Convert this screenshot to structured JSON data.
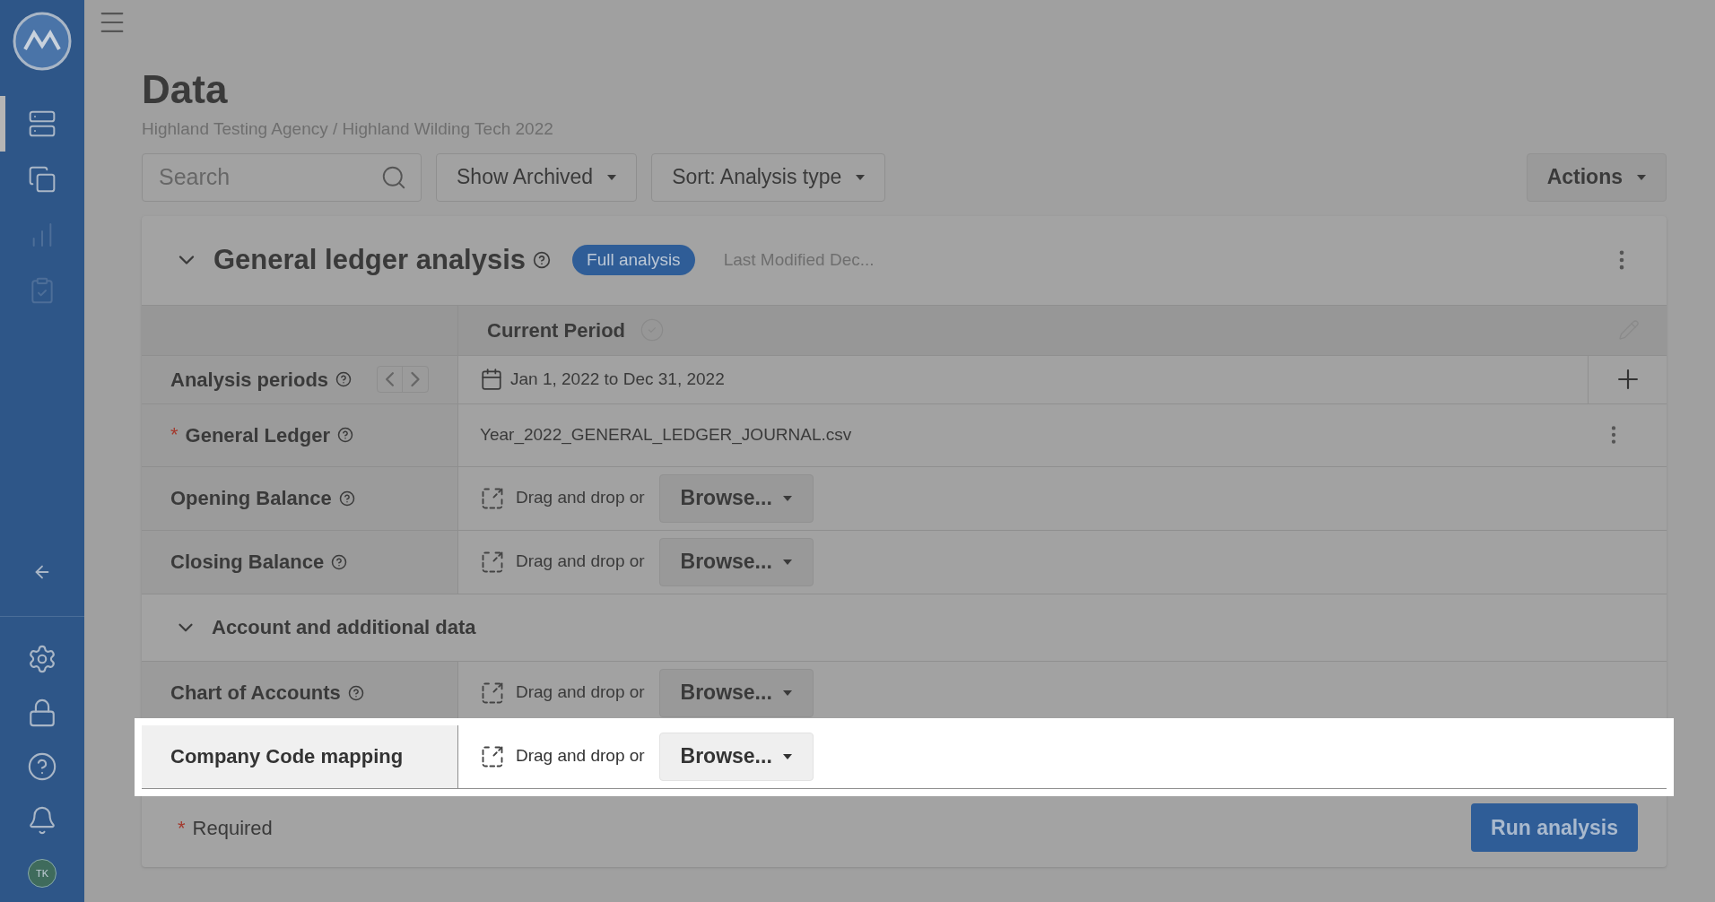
{
  "sidebar": {
    "nav": [
      {
        "kind": "data",
        "selected": true,
        "disabled": false
      },
      {
        "kind": "files",
        "selected": false,
        "disabled": false
      },
      {
        "kind": "chart",
        "selected": false,
        "disabled": true
      },
      {
        "kind": "review",
        "selected": false,
        "disabled": true
      }
    ],
    "bottom": [
      {
        "kind": "settings"
      },
      {
        "kind": "lock"
      },
      {
        "kind": "help"
      },
      {
        "kind": "bell"
      }
    ],
    "avatar": "TK"
  },
  "page": {
    "title": "Data",
    "breadcrumb": "Highland Testing Agency / Highland Wilding Tech 2022"
  },
  "toolbar": {
    "search": {
      "placeholder": "Search"
    },
    "show_archived": "Show Archived",
    "sort": "Sort: Analysis type",
    "actions": "Actions"
  },
  "analysis": {
    "title": "General ledger analysis",
    "expanded": true,
    "badge": "Full analysis",
    "modified": "Last Modified Dec...",
    "column": "Current Period",
    "rows": [
      {
        "kind": "period",
        "label": "Analysis periods",
        "required": false,
        "help": true,
        "highlighted": false,
        "value": "Jan 1, 2022 to Dec 31, 2022"
      },
      {
        "kind": "file",
        "label": "General Ledger",
        "required": true,
        "help": true,
        "highlighted": false,
        "value": "Year_2022_GENERAL_LEDGER_JOURNAL.csv"
      },
      {
        "kind": "upload",
        "label": "Opening Balance",
        "required": false,
        "help": true,
        "highlighted": false,
        "drop": "Drag and drop or",
        "browse": "Browse..."
      },
      {
        "kind": "upload",
        "label": "Closing Balance",
        "required": false,
        "help": true,
        "highlighted": false,
        "drop": "Drag and drop or",
        "browse": "Browse..."
      }
    ],
    "section": {
      "title": "Account and additional data",
      "expanded": true,
      "rows": [
        {
          "kind": "upload",
          "label": "Chart of Accounts",
          "required": false,
          "help": true,
          "highlighted": false,
          "drop": "Drag and drop or",
          "browse": "Browse..."
        },
        {
          "kind": "upload",
          "label": "Company Code mapping",
          "required": false,
          "help": false,
          "highlighted": true,
          "drop": "Drag and drop or",
          "browse": "Browse..."
        }
      ]
    },
    "asterisk": "*",
    "required_note": "Required",
    "run": "Run analysis"
  }
}
